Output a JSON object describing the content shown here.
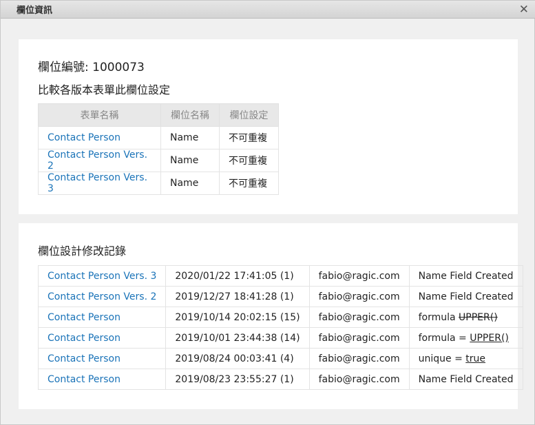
{
  "window": {
    "title": "欄位資訊",
    "close_glyph": "✕"
  },
  "field_info": {
    "label": "欄位編號: ",
    "field_id": "1000073",
    "compare_title": "比較各版本表單此欄位設定"
  },
  "compare_table": {
    "headers": [
      "表單名稱",
      "欄位名稱",
      "欄位設定"
    ],
    "rows": [
      {
        "form": "Contact Person",
        "field_name": "Name",
        "setting": "不可重複"
      },
      {
        "form": "Contact Person Vers. 2",
        "field_name": "Name",
        "setting": "不可重複"
      },
      {
        "form": "Contact Person Vers. 3",
        "field_name": "Name",
        "setting": "不可重複"
      }
    ]
  },
  "history": {
    "title": "欄位設計修改記錄",
    "rows": [
      {
        "form": "Contact Person Vers. 3",
        "time": "2020/01/22 17:41:05 (1)",
        "user": "fabio@ragic.com",
        "change_prefix": "Name Field Created",
        "change_value": "",
        "style": "plain"
      },
      {
        "form": "Contact Person Vers. 2",
        "time": "2019/12/27 18:41:28 (1)",
        "user": "fabio@ragic.com",
        "change_prefix": "Name Field Created",
        "change_value": "",
        "style": "plain"
      },
      {
        "form": "Contact Person",
        "time": "2019/10/14 20:02:15 (15)",
        "user": "fabio@ragic.com",
        "change_prefix": "formula ",
        "change_value": "UPPER()",
        "style": "strike"
      },
      {
        "form": "Contact Person",
        "time": "2019/10/01 23:44:38 (14)",
        "user": "fabio@ragic.com",
        "change_prefix": "formula = ",
        "change_value": "UPPER()",
        "style": "under"
      },
      {
        "form": "Contact Person",
        "time": "2019/08/24 00:03:41 (4)",
        "user": "fabio@ragic.com",
        "change_prefix": "unique = ",
        "change_value": "true",
        "style": "under"
      },
      {
        "form": "Contact Person",
        "time": "2019/08/23 23:55:27 (1)",
        "user": "fabio@ragic.com",
        "change_prefix": "Name Field Created",
        "change_value": "",
        "style": "plain"
      }
    ]
  },
  "colors": {
    "link": "#1a73b8",
    "header_bg": "#e8e8e8",
    "panel_bg": "#ffffff",
    "backdrop": "#f0f0f0"
  }
}
